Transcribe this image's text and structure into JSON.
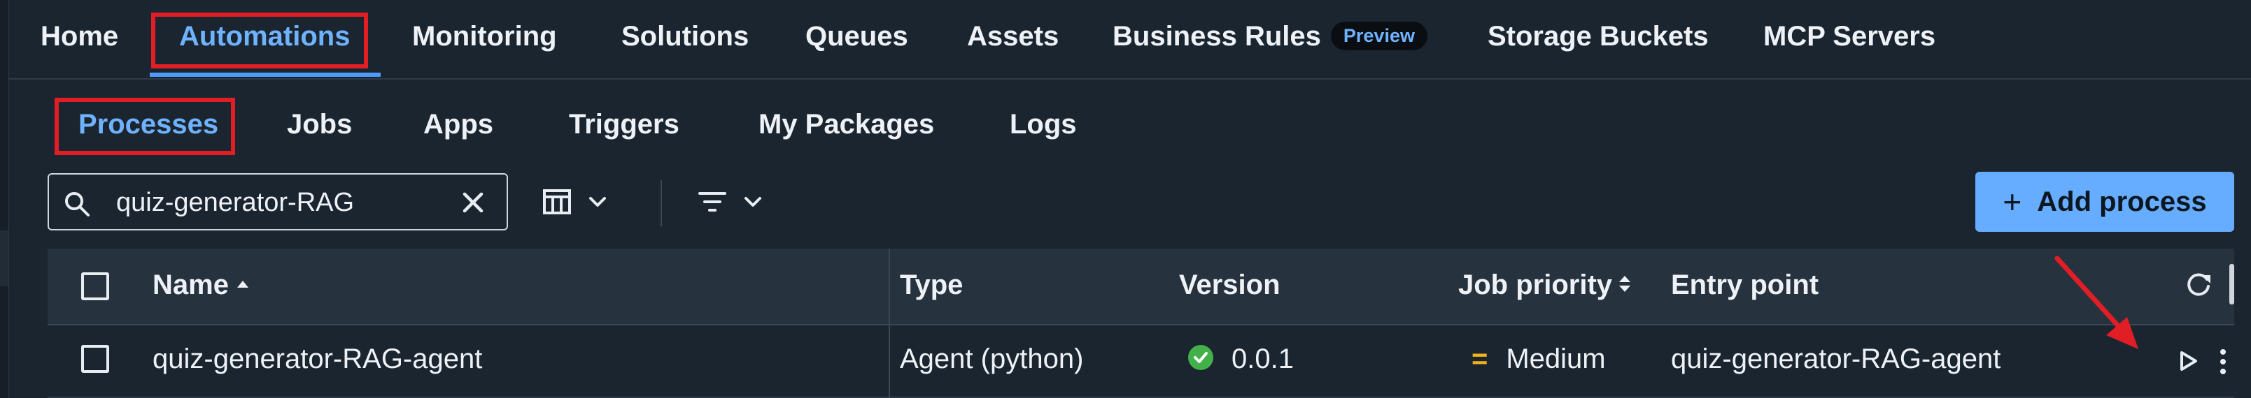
{
  "topnav": {
    "items": [
      "Home",
      "Automations",
      "Monitoring",
      "Solutions",
      "Queues",
      "Assets",
      "Business Rules",
      "Storage Buckets",
      "MCP Servers"
    ],
    "business_rules_badge": "Preview"
  },
  "subtabs": [
    "Processes",
    "Jobs",
    "Apps",
    "Triggers",
    "My Packages",
    "Logs"
  ],
  "search": {
    "value": "quiz-generator-RAG"
  },
  "toolbar": {
    "add_label": "Add process",
    "add_icon": "plus-icon"
  },
  "table": {
    "columns": [
      "Name",
      "Type",
      "Version",
      "Job priority",
      "Entry point"
    ],
    "name_sort": "ascending",
    "rows": [
      {
        "name": "quiz-generator-RAG-agent",
        "type": "Agent (python)",
        "version": "0.0.1",
        "version_status": "ok",
        "priority": "Medium",
        "priority_icon": "=",
        "entry_point": "quiz-generator-RAG-agent"
      }
    ]
  },
  "annotations": {
    "highlight_color": "#e11d25",
    "highlighted": [
      "Automations",
      "Processes",
      "run-button"
    ]
  },
  "colors": {
    "accent": "#66adff",
    "background": "#1b2530",
    "status_ok": "#43b14a",
    "priority_medium": "#f2b418"
  }
}
